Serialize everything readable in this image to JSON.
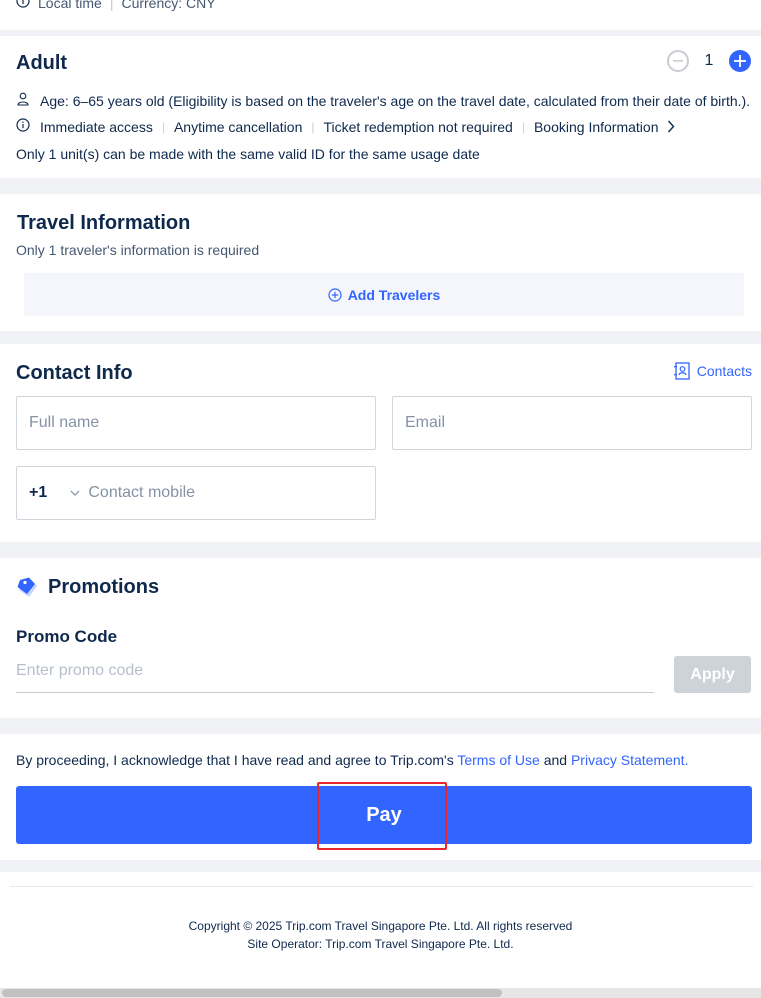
{
  "top": {
    "local_time": "Local time",
    "currency": "Currency: CNY"
  },
  "adult": {
    "title": "Adult",
    "quantity": "1",
    "age_text": "Age: 6–65 years old (Eligibility is based on the traveler's age on the travel date, calculated from their date of birth.).",
    "features": [
      "Immediate access",
      "Anytime cancellation",
      "Ticket redemption not required",
      "Booking Information"
    ],
    "unit_note": "Only 1 unit(s) can be made with the same valid ID for the same usage date"
  },
  "travel": {
    "title": "Travel Information",
    "subtitle": "Only 1 traveler's information is required",
    "add_label": "Add Travelers"
  },
  "contact": {
    "title": "Contact Info",
    "contacts_link": "Contacts",
    "fullname_placeholder": "Full name",
    "email_placeholder": "Email",
    "country_code": "+1",
    "mobile_placeholder": "Contact mobile"
  },
  "promo": {
    "title": "Promotions",
    "code_label": "Promo Code",
    "code_placeholder": "Enter promo code",
    "apply_label": "Apply"
  },
  "pay": {
    "agree_prefix": "By proceeding, I acknowledge that I have read and agree to Trip.com's",
    "terms_link": "Terms of Use",
    "and_text": "and",
    "privacy_link": "Privacy Statement.",
    "pay_label": "Pay"
  },
  "footer": {
    "copyright": "Copyright © 2025 Trip.com Travel Singapore Pte. Ltd. All rights reserved",
    "operator": "Site Operator: Trip.com Travel Singapore Pte. Ltd."
  },
  "colors": {
    "accent": "#3264ff",
    "highlight": "#e8262b",
    "text": "#0f294d"
  }
}
